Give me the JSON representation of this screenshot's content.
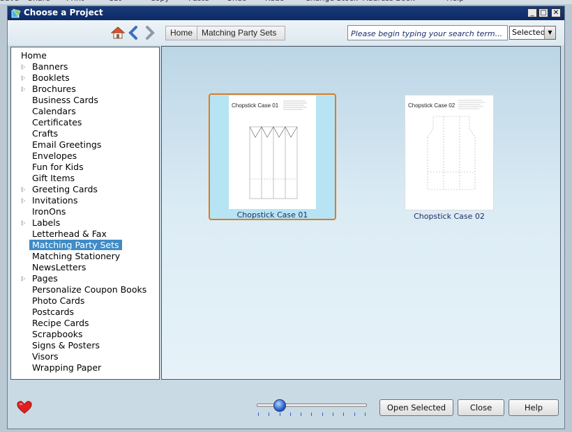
{
  "menubar": {
    "items": [
      "Save",
      "Share",
      "Print",
      "Cut",
      "Copy",
      "Paste",
      "Undo",
      "Redo",
      "Change Stock",
      "Address Book",
      "Help"
    ]
  },
  "window": {
    "title": "Choose a Project"
  },
  "toolbar": {
    "breadcrumb": [
      "Home",
      "Matching Party Sets"
    ],
    "search_placeholder": "Please begin typing your search term...",
    "filter_value": "Selected"
  },
  "tree": {
    "items": [
      {
        "label": "Home",
        "expandable": false,
        "root": true
      },
      {
        "label": "Banners",
        "expandable": true
      },
      {
        "label": "Booklets",
        "expandable": true
      },
      {
        "label": "Brochures",
        "expandable": true
      },
      {
        "label": "Business Cards",
        "expandable": false
      },
      {
        "label": "Calendars",
        "expandable": false
      },
      {
        "label": "Certificates",
        "expandable": false
      },
      {
        "label": "Crafts",
        "expandable": false
      },
      {
        "label": "Email Greetings",
        "expandable": false
      },
      {
        "label": "Envelopes",
        "expandable": false
      },
      {
        "label": "Fun for Kids",
        "expandable": false
      },
      {
        "label": "Gift Items",
        "expandable": false
      },
      {
        "label": "Greeting Cards",
        "expandable": true
      },
      {
        "label": "Invitations",
        "expandable": true
      },
      {
        "label": "IronOns",
        "expandable": false
      },
      {
        "label": "Labels",
        "expandable": true
      },
      {
        "label": "Letterhead & Fax",
        "expandable": false
      },
      {
        "label": "Matching Party Sets",
        "expandable": false,
        "selected": true
      },
      {
        "label": "Matching Stationery",
        "expandable": false
      },
      {
        "label": "NewsLetters",
        "expandable": false
      },
      {
        "label": "Pages",
        "expandable": true
      },
      {
        "label": "Personalize Coupon Books",
        "expandable": false
      },
      {
        "label": "Photo Cards",
        "expandable": false
      },
      {
        "label": "Postcards",
        "expandable": false
      },
      {
        "label": "Recipe Cards",
        "expandable": false
      },
      {
        "label": "Scrapbooks",
        "expandable": false
      },
      {
        "label": "Signs & Posters",
        "expandable": false
      },
      {
        "label": "Visors",
        "expandable": false
      },
      {
        "label": "Wrapping Paper",
        "expandable": false
      }
    ]
  },
  "projects": [
    {
      "caption": "Chopstick Case 01",
      "thumb_title": "Chopstick Case 01",
      "selected": true
    },
    {
      "caption": "Chopstick Case 02",
      "thumb_title": "Chopstick Case 02",
      "selected": false
    }
  ],
  "footer": {
    "open_label": "Open Selected",
    "close_label": "Close",
    "help_label": "Help",
    "zoom_level": 0.2
  },
  "colors": {
    "accent": "#3f8bc7",
    "selection_border": "#e07b1a",
    "title_bar": "#0c2a66"
  }
}
